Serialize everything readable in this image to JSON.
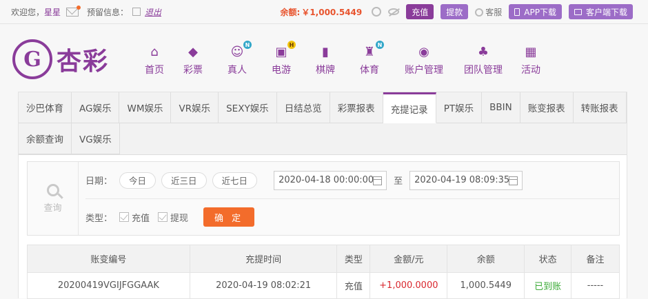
{
  "topbar": {
    "welcome": "欢迎您，",
    "username": "星星",
    "alert_label": "预留信息：",
    "logout": "退出",
    "balance_label": "余额:",
    "balance_value": "￥1,000.5449",
    "recharge": "充值",
    "withdraw": "提款",
    "service": "客服",
    "app_download": "APP下载",
    "client_download": "客户端下载"
  },
  "logo": {
    "glyph": "G",
    "text": "杏彩"
  },
  "nav": [
    {
      "label": "首页",
      "icon": "home-icon",
      "glyph": "⌂"
    },
    {
      "label": "彩票",
      "icon": "lottery-icon",
      "glyph": "◆"
    },
    {
      "label": "真人",
      "icon": "live-dealer-icon",
      "glyph": "☺",
      "badge": "N"
    },
    {
      "label": "电游",
      "icon": "gamepad-icon",
      "glyph": "▣",
      "badge": "H"
    },
    {
      "label": "棋牌",
      "icon": "cards-icon",
      "glyph": "▮"
    },
    {
      "label": "体育",
      "icon": "trophy-icon",
      "glyph": "♜",
      "badge": "N"
    },
    {
      "label": "账户管理",
      "icon": "account-icon",
      "glyph": "◉"
    },
    {
      "label": "团队管理",
      "icon": "team-icon",
      "glyph": "♣"
    },
    {
      "label": "活动",
      "icon": "gift-icon",
      "glyph": "▦"
    }
  ],
  "tabs": [
    "沙巴体育",
    "AG娱乐",
    "WM娱乐",
    "VR娱乐",
    "SEXY娱乐",
    "日结总览",
    "彩票报表",
    "充提记录",
    "PT娱乐",
    "BBIN",
    "账变报表",
    "转账报表",
    "余额查询",
    "VG娱乐"
  ],
  "active_tab": "充提记录",
  "query": {
    "title": "查询",
    "date_label": "日期：",
    "quick": [
      "今日",
      "近三日",
      "近七日"
    ],
    "start": "2020-04-18 00:00:00",
    "to": "至",
    "end": "2020-04-19 08:09:35",
    "type_label": "类型：",
    "types": [
      "充值",
      "提现"
    ],
    "confirm": "确 定"
  },
  "table": {
    "headers": [
      "账变编号",
      "充提时间",
      "类型",
      "金额/元",
      "余额",
      "状态",
      "备注"
    ],
    "rows": [
      [
        "20200419VGIJFGGAAK",
        "2020-04-19 08:02:21",
        "充值",
        "+1,000.0000",
        "1,000.5449",
        "已到账",
        "-----"
      ]
    ]
  },
  "colors": {
    "brand": "#8a3c9a",
    "accent": "#f36c2b",
    "amount_positive": "#d9272e",
    "status_ok": "#3aaa35"
  }
}
